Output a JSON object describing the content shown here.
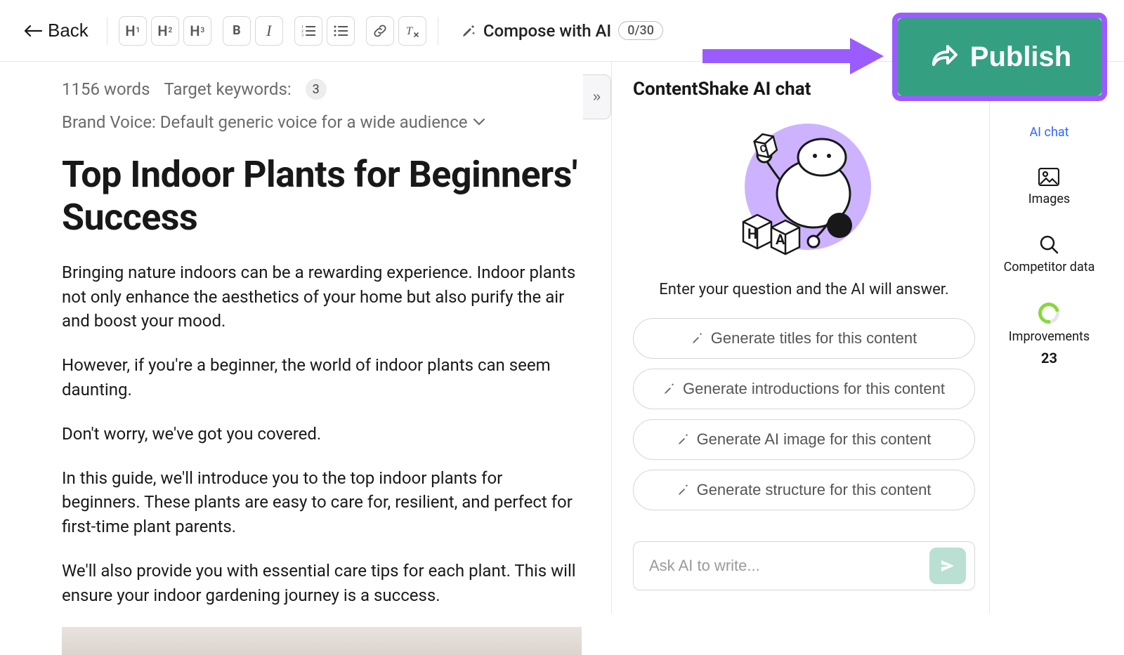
{
  "toolbar": {
    "back_label": "Back",
    "compose_label": "Compose with AI",
    "compose_usage": "0/30",
    "publish_label": "Publish"
  },
  "editor": {
    "word_count": "1156 words",
    "target_keywords_label": "Target keywords:",
    "target_keywords_count": "3",
    "brand_voice_label": "Brand Voice: Default generic voice for a wide audience",
    "title": "Top Indoor Plants for Beginners' Success",
    "paragraphs": [
      "Bringing nature indoors can be a rewarding experience. Indoor plants not only enhance the aesthetics of your home but also purify the air and boost your mood.",
      "However, if you're a beginner, the world of indoor plants can seem daunting.",
      "Don't worry, we've got you covered.",
      "In this guide, we'll introduce you to the top indoor plants for beginners. These plants are easy to care for, resilient, and perfect for first-time plant parents.",
      "We'll also provide you with essential care tips for each plant. This will ensure your indoor gardening journey is a success."
    ]
  },
  "chat": {
    "title": "ContentShake AI chat",
    "hint": "Enter your question and the AI will answer.",
    "suggestions": [
      "Generate titles for this content",
      "Generate introductions for this content",
      "Generate AI image for this content",
      "Generate structure for this content"
    ],
    "input_placeholder": "Ask AI to write..."
  },
  "rightnav": {
    "ai_chat": "AI chat",
    "images": "Images",
    "competitor": "Competitor data",
    "improvements": "Improvements",
    "improvements_count": "23"
  }
}
